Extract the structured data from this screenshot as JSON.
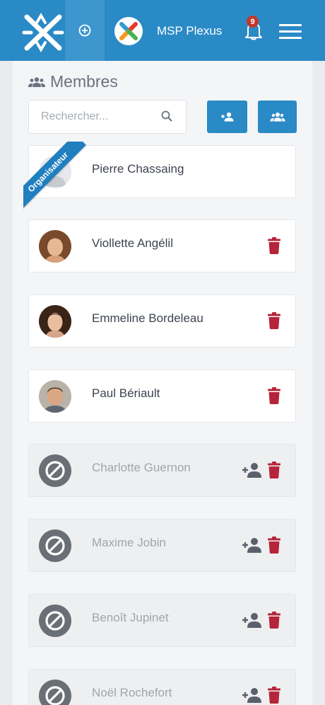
{
  "header": {
    "org_name": "MSP Plexus",
    "notification_count": "9",
    "icons": [
      "app-logo-icon",
      "add-circle-icon",
      "org-logo-icon",
      "bell-icon",
      "hamburger-menu-icon"
    ],
    "color": "#2a8ac6"
  },
  "members": {
    "title": "Membres",
    "search_placeholder": "Rechercher...",
    "buttons": [
      "add-member-icon",
      "add-group-icon"
    ],
    "organizer_badge": "Organisateur",
    "list": [
      {
        "name": "Pierre Chassaing",
        "status": "organizer"
      },
      {
        "name": "Viollette Angélil",
        "status": "active"
      },
      {
        "name": "Emmeline Bordeleau",
        "status": "active"
      },
      {
        "name": "Paul Bériault",
        "status": "active"
      },
      {
        "name": "Charlotte Guernon",
        "status": "disabled"
      },
      {
        "name": "Maxime Jobin",
        "status": "disabled"
      },
      {
        "name": "Benoît Jupinet",
        "status": "disabled"
      },
      {
        "name": "Noël Rochefort",
        "status": "disabled"
      }
    ],
    "colors": {
      "delete": "#b5243a",
      "restore": "#5a616b"
    }
  }
}
